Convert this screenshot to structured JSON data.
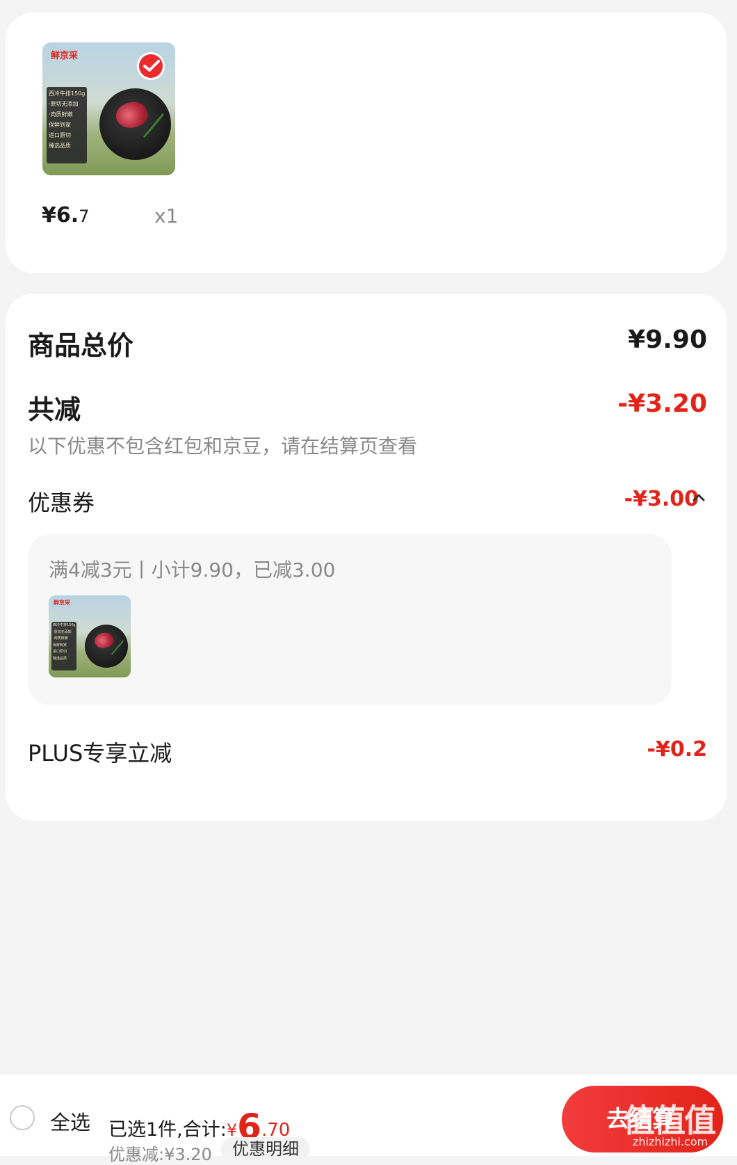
{
  "product": {
    "brand": "鲜京采",
    "panel_lines": [
      "西冷牛排150g",
      "·原切无添加",
      "·肉质鲜嫩",
      "保鲜到家",
      "进口原切",
      "臻选品质"
    ],
    "price_int": "¥6.",
    "price_dec": "7",
    "quantity": "x1",
    "selected": true
  },
  "summary": {
    "total_label": "商品总价",
    "total_value": "¥9.90",
    "reduce_label": "共减",
    "reduce_value": "-¥3.20",
    "note": "以下优惠不包含红包和京豆，请在结算页查看",
    "coupon_label": "优惠券",
    "coupon_value": "-¥3.00",
    "coupon_desc": "满4减3元丨小计9.90，已减3.00",
    "plus_label": "PLUS专享立减",
    "plus_value": "-¥0.2"
  },
  "bottom_bar": {
    "select_all": "全选",
    "selected_prefix": "已选1件,合计:",
    "currency": "¥",
    "total_int": "6",
    "total_dec": ".70",
    "discount": "优惠减:¥3.20",
    "detail": "优惠明细",
    "checkout": "去结算"
  },
  "watermark": {
    "text": "值值值",
    "url": "zhizhizhi.com"
  },
  "colors": {
    "accent": "#e2231a",
    "background": "#f4f4f4"
  }
}
